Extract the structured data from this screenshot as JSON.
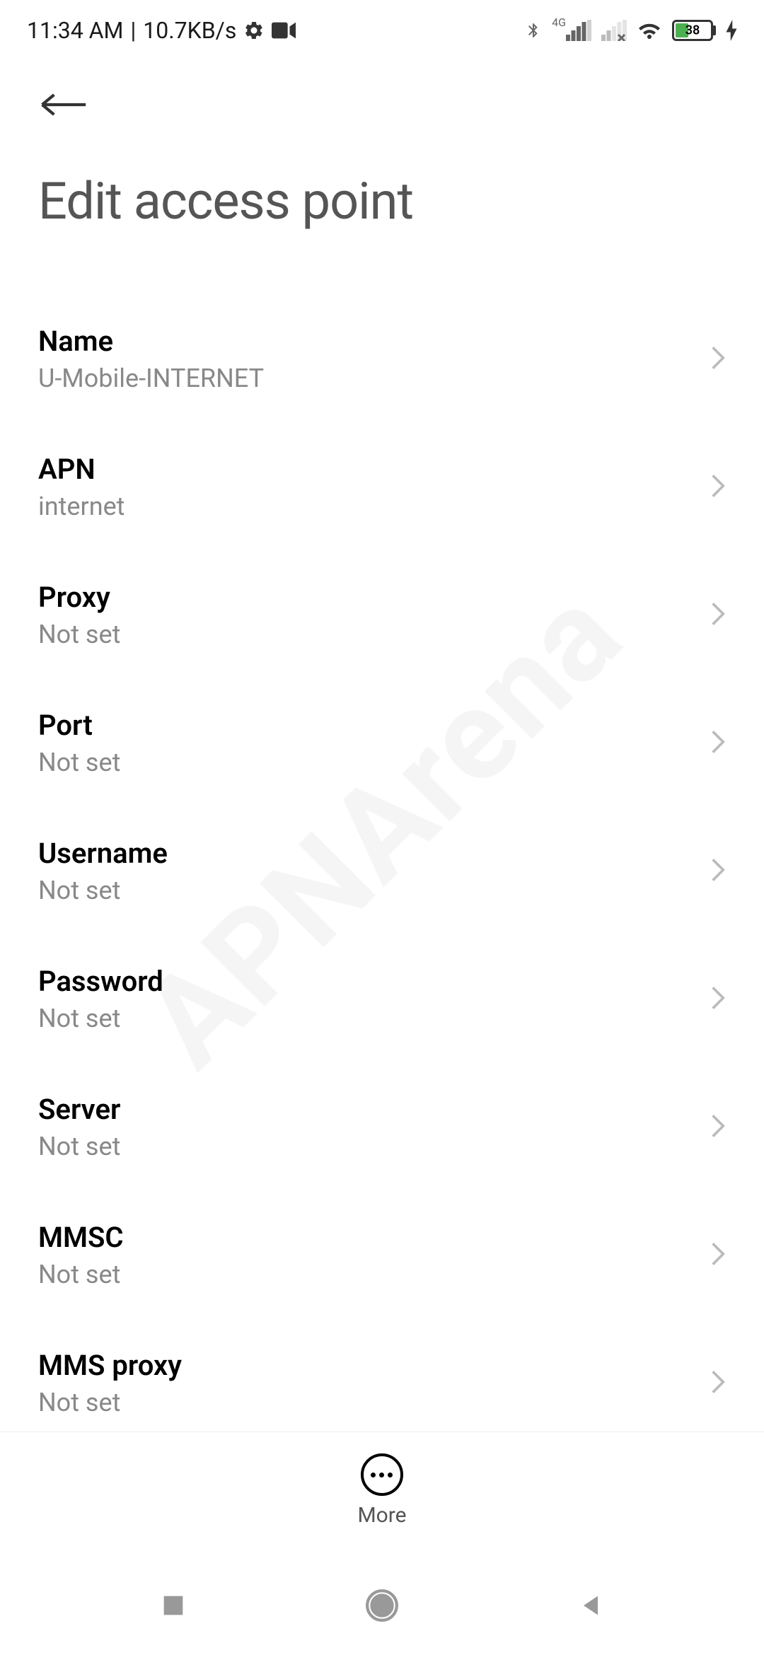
{
  "status_bar": {
    "time": "11:34 AM",
    "speed": "10.7KB/s",
    "battery": "38",
    "network_label": "4G"
  },
  "header": {
    "title": "Edit access point"
  },
  "settings": [
    {
      "label": "Name",
      "value": "U-Mobile-INTERNET"
    },
    {
      "label": "APN",
      "value": "internet"
    },
    {
      "label": "Proxy",
      "value": "Not set"
    },
    {
      "label": "Port",
      "value": "Not set"
    },
    {
      "label": "Username",
      "value": "Not set"
    },
    {
      "label": "Password",
      "value": "Not set"
    },
    {
      "label": "Server",
      "value": "Not set"
    },
    {
      "label": "MMSC",
      "value": "Not set"
    },
    {
      "label": "MMS proxy",
      "value": "Not set"
    }
  ],
  "toolbar": {
    "more_label": "More"
  },
  "watermark": "APNArena"
}
